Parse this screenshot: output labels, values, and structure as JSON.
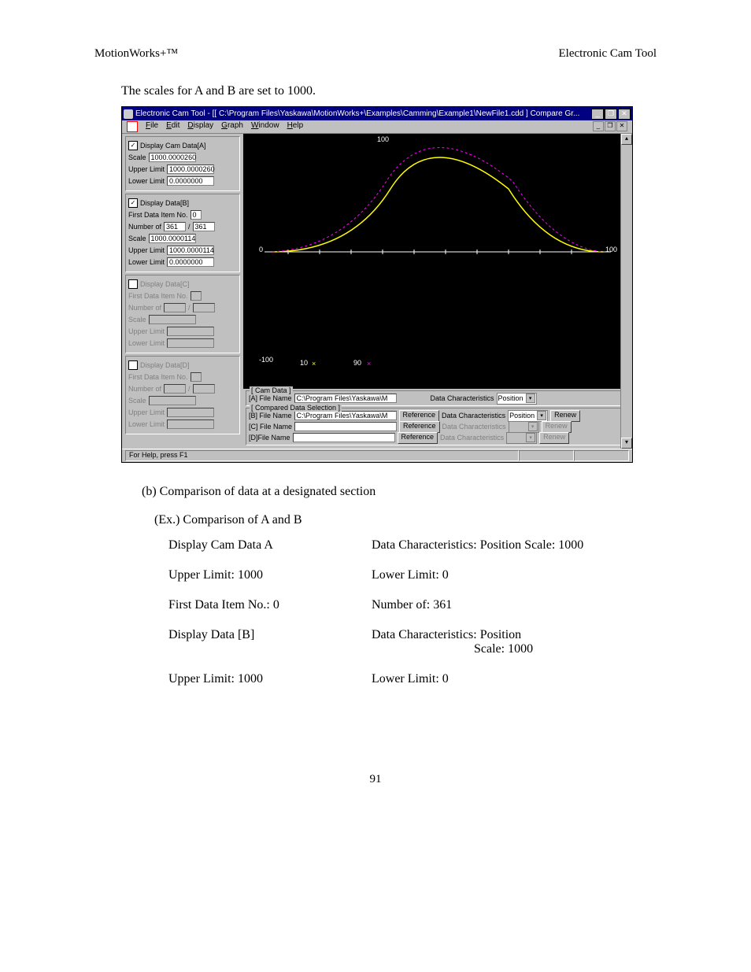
{
  "header": {
    "left": "MotionWorks+™",
    "right": "Electronic Cam Tool"
  },
  "intro": "The scales for A and B are set to 1000.",
  "app": {
    "title": "Electronic Cam Tool - [[ C:\\Program Files\\Yaskawa\\MotionWorks+\\Examples\\Camming\\Example1\\NewFile1.cdd ] Compare Gr...",
    "menus": {
      "file": "File",
      "edit": "Edit",
      "display": "Display",
      "graph": "Graph",
      "window": "Window",
      "help": "Help"
    },
    "panelA": {
      "title": "Display Cam Data[A]",
      "scale_label": "Scale",
      "scale": "1000.0000260",
      "upper_label": "Upper Limit",
      "upper": "1000.0000260",
      "lower_label": "Lower Limit",
      "lower": "0.0000000"
    },
    "panelB": {
      "title": "Display Data[B]",
      "first_label": "First Data Item No.",
      "first": "0",
      "num_label": "Number of",
      "num1": "361",
      "num2": "361",
      "scale_label": "Scale",
      "scale": "1000.0000114",
      "upper_label": "Upper Limit",
      "upper": "1000.0000114",
      "lower_label": "Lower Limit",
      "lower": "0.0000000"
    },
    "panelC": {
      "title": "Display Data[C]",
      "first_label": "First Data Item No.",
      "num_label": "Number of",
      "scale_label": "Scale",
      "upper_label": "Upper Limit",
      "lower_label": "Lower Limit"
    },
    "panelD": {
      "title": "Display Data[D]",
      "first_label": "First Data Item No.",
      "num_label": "Number of",
      "scale_label": "Scale",
      "upper_label": "Upper Limit",
      "lower_label": "Lower Limit"
    },
    "graph": {
      "y_top": "100",
      "y_bot": "-100",
      "x_right": "100",
      "x_left": "0",
      "tick1": "10",
      "tick2": "90"
    },
    "camdata": {
      "legend": "[ Cam Data ]",
      "a_label": "[A] File Name",
      "a_val": "C:\\Program Files\\Yaskawa\\M",
      "dc_label": "Data Characteristics",
      "dc_val": "Position"
    },
    "compared": {
      "legend": "[ Compared Data Selection ]",
      "b_label": "[B] File Name",
      "b_val": "C:\\Program Files\\Yaskawa\\M",
      "c_label": "[C] File Name",
      "c_val": "",
      "d_label": "[D]File Name",
      "d_val": "",
      "ref": "Reference",
      "dc": "Data Characteristics",
      "dc_val": "Position",
      "renew": "Renew"
    },
    "status": "For Help, press F1"
  },
  "subsection": "(b) Comparison of data at a designated section",
  "example": "(Ex.) Comparison of A and B",
  "table": {
    "r1c1": "Display Cam Data A",
    "r1c2": "Data Characteristics: Position Scale: 1000",
    "r2c1": "Upper Limit: 1000",
    "r2c2": "Lower Limit: 0",
    "r3c1": "First Data Item No.: 0",
    "r3c2": "Number of: 361",
    "r4c1": "Display Data [B]",
    "r4c2a": "Data Characteristics:  Position",
    "r4c2b": "Scale: 1000",
    "r5c1": "Upper Limit: 1000",
    "r5c2": "Lower Limit: 0"
  },
  "pagenum": "91"
}
